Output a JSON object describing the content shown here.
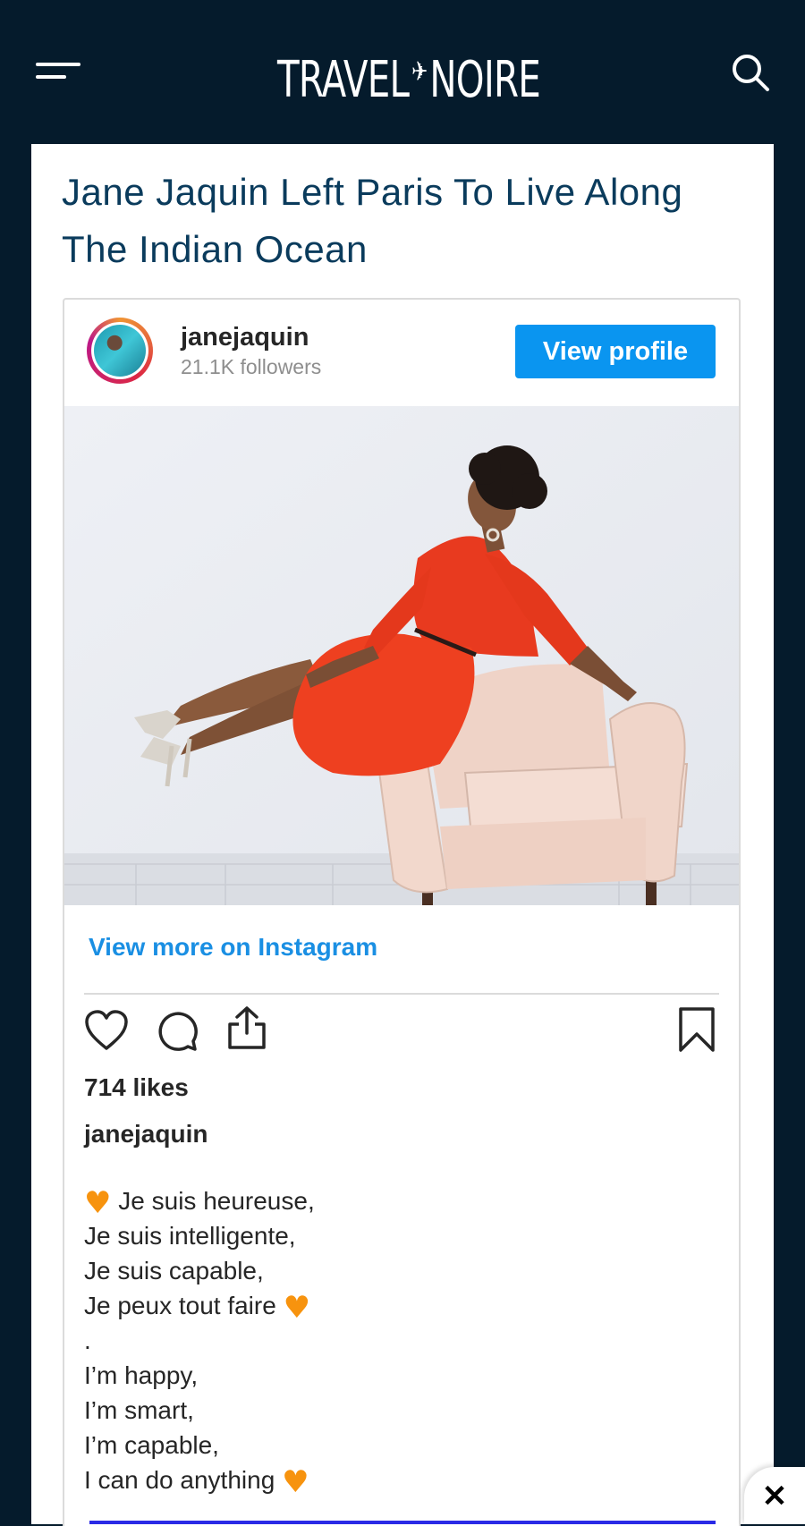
{
  "site": {
    "logo_left": "TRAVEL",
    "logo_right": "NOIRE"
  },
  "article": {
    "title": "Jane Jaquin Left Paris To Live Along The Indian Ocean"
  },
  "embed": {
    "username": "janejaquin",
    "followers": "21.1K followers",
    "view_profile_label": "View profile",
    "view_more_label": "View more on Instagram",
    "likes": "714 likes",
    "caption_user": "janejaquin",
    "caption_lines": [
      "Je suis heureuse,",
      "Je suis intelligente,",
      "Je suis capable,",
      "Je peux tout faire",
      ".",
      "I’m happy,",
      "I’m smart,",
      "I’m capable,",
      "I can do anything"
    ]
  },
  "colors": {
    "navy": "#051b2c",
    "title": "#0a3b5c",
    "instagram_blue": "#0a95f0",
    "heart": "#f7930e"
  },
  "icons": [
    "menu-icon",
    "search-icon",
    "plane-icon",
    "like-icon",
    "comment-icon",
    "share-icon",
    "bookmark-icon",
    "close-icon",
    "heart-emoji-icon"
  ]
}
